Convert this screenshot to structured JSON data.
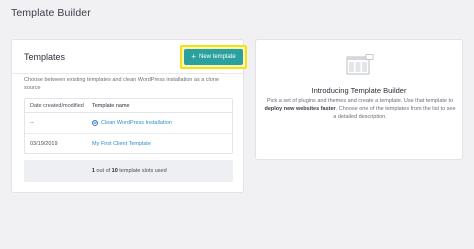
{
  "header": {
    "title": "Template Builder"
  },
  "templates_card": {
    "title": "Templates",
    "new_button_label": "New template",
    "description": "Choose between existing templates and clean WordPress installation as a clone source",
    "table": {
      "headers": [
        "Date created/modified",
        "Template name"
      ],
      "rows": [
        {
          "date": "--",
          "name": "Clean WordPress Installation",
          "icon": "wordpress-icon"
        },
        {
          "date": "03/19/2019",
          "name": "My First Client Template"
        }
      ]
    },
    "slots": {
      "used": "1",
      "middle": "out of",
      "total": "10",
      "suffix": "template slots used"
    }
  },
  "intro_card": {
    "title": "Introducing Template Builder",
    "text_part1": "Pick a set of plugins and themes and create a template. Use that template to ",
    "text_bold": "deploy new websites faster",
    "text_part2": ". Choose one of the templates from the list to see a detailed description."
  },
  "colors": {
    "accent": "#2aa19f",
    "highlight": "#f2e215",
    "link": "#2f8fd0"
  }
}
